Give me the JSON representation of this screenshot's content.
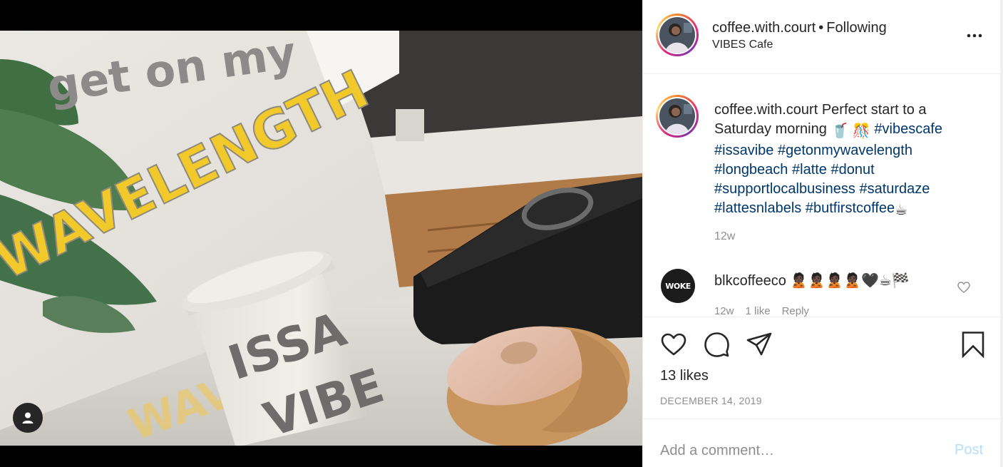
{
  "post": {
    "photo": {
      "description_icon": "photo",
      "wall_text_line1": "get on my",
      "wall_text_line2": "WAVELENGTH",
      "cup_text_line1": "ISSA",
      "cup_text_line2": "VIBE"
    },
    "user_tag_icon": "person-icon"
  },
  "header": {
    "username": "coffee.with.court",
    "bullet": "•",
    "follow_status": "Following",
    "location": "VIBES Cafe",
    "more_icon": "more-horizontal-icon"
  },
  "caption": {
    "username": "coffee.with.court",
    "text": "Perfect start to a Saturday morning",
    "emoji_1": "🥤",
    "emoji_2": "🎊",
    "hashtags": [
      "#vibescafe",
      "#issavibe",
      "#getonmywavelength",
      "#longbeach",
      "#latte",
      "#donut",
      "#supportlocalbusiness",
      "#saturdaze",
      "#lattesnlabels",
      "#butfirstcoffee"
    ],
    "emoji_end": "☕",
    "time": "12w"
  },
  "comment": {
    "username": "blkcoffeeco",
    "avatar_text": "WOKE",
    "emojis": "🙎🏿🙎🏿🙎🏿🙎🏿🖤☕🏁",
    "time": "12w",
    "likes": "1 like",
    "reply": "Reply"
  },
  "actions": {
    "like_icon": "heart-icon",
    "comment_icon": "comment-icon",
    "share_icon": "paper-plane-icon",
    "save_icon": "bookmark-icon",
    "likes_text": "13 likes",
    "date": "DECEMBER 14, 2019"
  },
  "comment_box": {
    "placeholder": "Add a comment…",
    "post_label": "Post"
  },
  "colors": {
    "hashtag": "#00376b",
    "muted": "#8e8e8e",
    "post_disabled": "#b2dffc",
    "wall_yellow": "#f2c92b"
  }
}
